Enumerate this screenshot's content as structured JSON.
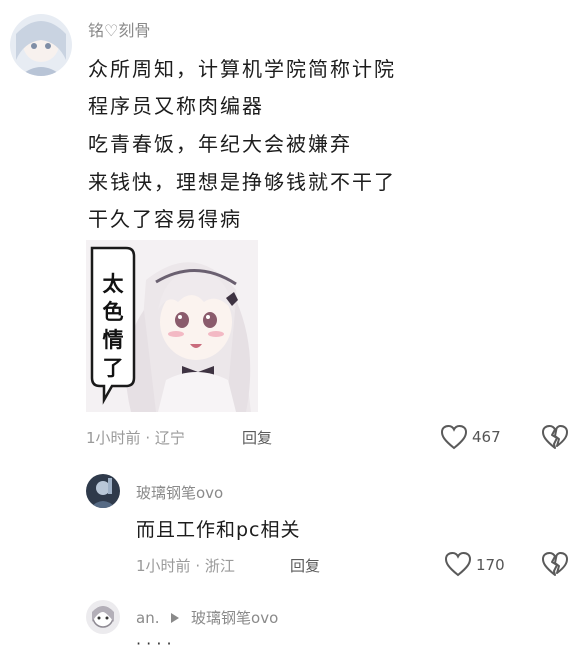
{
  "comment": {
    "username": "铭♡刻骨",
    "lines": [
      "众所周知，计算机学院简称计院",
      "程序员又称肉编器",
      "吃青春饭，年纪大会被嫌弃",
      "来钱快，理想是挣够钱就不干了",
      "干久了容易得病"
    ],
    "sticker_text": [
      "太",
      "色",
      "情",
      "了"
    ],
    "time": "1小时前",
    "location": "辽宁",
    "reply_label": "回复",
    "likes": "467"
  },
  "replies": [
    {
      "username": "玻璃钢笔ovo",
      "text": "而且工作和pc相关",
      "time": "1小时前",
      "location": "浙江",
      "reply_label": "回复",
      "likes": "170"
    },
    {
      "username": "an.",
      "reply_to": "玻璃钢笔ovo",
      "text": "· · · ·"
    }
  ],
  "colors": {
    "text": "#1c1c1c",
    "meta": "#9a9a9a",
    "icon": "#5a5a5a"
  }
}
